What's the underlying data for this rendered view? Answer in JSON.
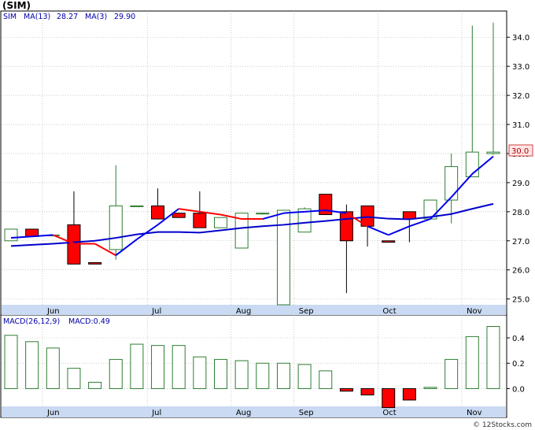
{
  "header": {
    "symbol_title": "(SIM)",
    "legend": {
      "symbol": "SIM",
      "ma13_label": "MA(13)",
      "ma13_value": "28.27",
      "ma3_label": "MA(3)",
      "ma3_value": "29.90"
    }
  },
  "footer": {
    "credit": "© 12Stocks.com"
  },
  "colors": {
    "up_candle": "#2e7d32",
    "down_candle_fill": "#ff0000",
    "ma13": "#0000cc",
    "ma3_up": "#0000ee",
    "ma3_down": "#ff0000",
    "macd_bar_up": "#2e7d32",
    "macd_bar_down": "#ff0000",
    "price_tag_border": "#d04040",
    "price_tag_fill": "#ffe6e6",
    "axis_band": "#c9daf2",
    "grid": "#aaaaaa"
  },
  "chart_data": [
    {
      "type": "candlestick",
      "title": "(SIM)",
      "period": "weekly",
      "ylim": [
        24.8,
        34.9
      ],
      "y_ticks": [
        25.0,
        26.0,
        27.0,
        28.0,
        29.0,
        30.0,
        31.0,
        32.0,
        33.0,
        34.0
      ],
      "x_tick_labels": [
        "Jun",
        "Jul",
        "Aug",
        "Sep",
        "Oct",
        "Nov"
      ],
      "month_start_index": [
        1.5,
        6.5,
        10.5,
        13.5,
        17.5,
        21.5
      ],
      "last_price_label": "30.0",
      "candles": [
        {
          "o": 27.0,
          "h": 27.4,
          "l": 27.0,
          "c": 27.4
        },
        {
          "o": 27.4,
          "h": 27.4,
          "l": 27.15,
          "c": 27.15
        },
        {
          "o": 27.2,
          "h": 27.2,
          "l": 27.15,
          "c": 27.2
        },
        {
          "o": 27.55,
          "h": 28.7,
          "l": 26.2,
          "c": 26.2
        },
        {
          "o": 26.25,
          "h": 26.25,
          "l": 26.2,
          "c": 26.2
        },
        {
          "o": 26.7,
          "h": 29.6,
          "l": 26.35,
          "c": 28.2
        },
        {
          "o": 28.2,
          "h": 28.2,
          "l": 28.2,
          "c": 28.2
        },
        {
          "o": 28.2,
          "h": 28.8,
          "l": 27.75,
          "c": 27.75
        },
        {
          "o": 27.95,
          "h": 27.95,
          "l": 27.8,
          "c": 27.8
        },
        {
          "o": 27.95,
          "h": 28.7,
          "l": 27.45,
          "c": 27.45
        },
        {
          "o": 27.45,
          "h": 27.8,
          "l": 27.45,
          "c": 27.8
        },
        {
          "o": 26.75,
          "h": 27.95,
          "l": 26.75,
          "c": 27.95
        },
        {
          "o": 27.95,
          "h": 27.95,
          "l": 27.9,
          "c": 27.95
        },
        {
          "o": 24.8,
          "h": 28.05,
          "l": 24.8,
          "c": 28.05
        },
        {
          "o": 27.3,
          "h": 28.15,
          "l": 27.3,
          "c": 28.1
        },
        {
          "o": 28.6,
          "h": 28.6,
          "l": 27.9,
          "c": 27.9
        },
        {
          "o": 28.0,
          "h": 28.25,
          "l": 25.2,
          "c": 27.0
        },
        {
          "o": 28.2,
          "h": 28.2,
          "l": 26.8,
          "c": 27.5
        },
        {
          "o": 27.0,
          "h": 27.0,
          "l": 26.95,
          "c": 26.95
        },
        {
          "o": 28.0,
          "h": 28.0,
          "l": 26.95,
          "c": 27.75
        },
        {
          "o": 27.75,
          "h": 28.4,
          "l": 27.75,
          "c": 28.4
        },
        {
          "o": 28.4,
          "h": 30.0,
          "l": 27.6,
          "c": 29.55
        },
        {
          "o": 29.2,
          "h": 34.4,
          "l": 29.2,
          "c": 30.05
        },
        {
          "o": 30.0,
          "h": 34.5,
          "l": 29.95,
          "c": 30.05
        }
      ],
      "series": [
        {
          "name": "MA(13)",
          "values": [
            26.82,
            26.86,
            26.9,
            26.95,
            27.0,
            27.1,
            27.22,
            27.3,
            27.3,
            27.28,
            27.36,
            27.44,
            27.5,
            27.55,
            27.62,
            27.68,
            27.75,
            27.82,
            27.76,
            27.74,
            27.82,
            27.92,
            28.1,
            28.27
          ]
        },
        {
          "name": "MA(3)",
          "values": [
            27.1,
            27.15,
            27.2,
            26.9,
            26.9,
            26.5,
            27.05,
            27.55,
            28.1,
            28.0,
            27.9,
            27.75,
            27.75,
            27.95,
            28.0,
            28.05,
            27.95,
            27.5,
            27.2,
            27.5,
            27.75,
            28.5,
            29.3,
            29.9
          ],
          "color_segments": [
            "up",
            "up",
            "up",
            "down",
            "down",
            "down",
            "up",
            "up",
            "up",
            "down",
            "down",
            "down",
            "down",
            "up",
            "up",
            "up",
            "up",
            "down",
            "up",
            "up",
            "up",
            "up",
            "up",
            "up"
          ]
        }
      ]
    },
    {
      "type": "bar",
      "title": "MACD(26,12,9)",
      "legend_label": "MACD(26,12,9)",
      "value_label": "MACD:0.49",
      "ylim": [
        -0.14,
        0.58
      ],
      "y_ticks": [
        0.0,
        0.2,
        0.4
      ],
      "x_tick_labels": [
        "Jun",
        "Jul",
        "Aug",
        "Sep",
        "Oct",
        "Nov"
      ],
      "values": [
        0.42,
        0.37,
        0.32,
        0.16,
        0.05,
        0.23,
        0.35,
        0.34,
        0.34,
        0.25,
        0.23,
        0.22,
        0.2,
        0.2,
        0.19,
        0.14,
        -0.02,
        -0.05,
        -0.15,
        -0.09,
        0.01,
        0.23,
        0.41,
        0.49
      ]
    }
  ]
}
